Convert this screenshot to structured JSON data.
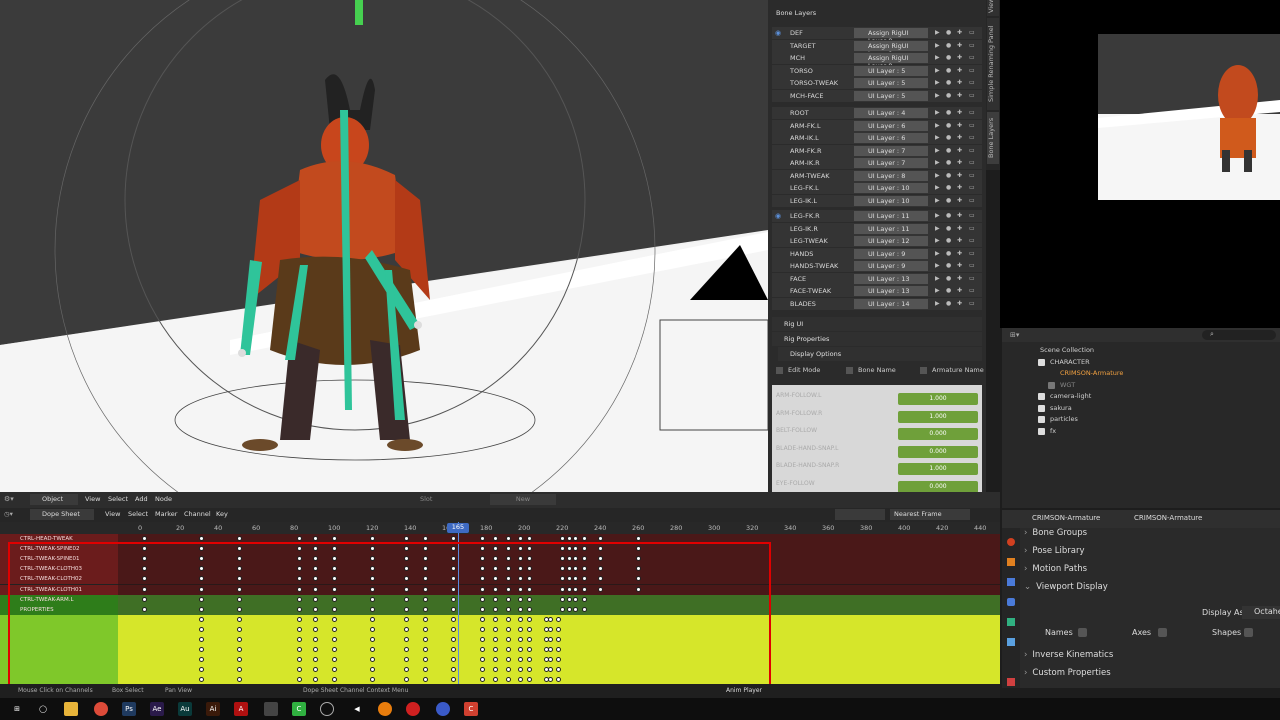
{
  "bone_layers": {
    "title": "Bone Layers",
    "rows": [
      {
        "name": "DEF",
        "layer": "Assign RigUI Layer",
        "num": "0",
        "eye": true
      },
      {
        "name": "TARGET",
        "layer": "Assign RigUI Layer",
        "num": "0",
        "eye": false
      },
      {
        "name": "MCH",
        "layer": "Assign RigUI Layer",
        "num": "0",
        "eye": false
      },
      {
        "name": "TORSO",
        "layer": "UI Layer :",
        "num": "5",
        "eye": false
      },
      {
        "name": "TORSO-TWEAK",
        "layer": "UI Layer :",
        "num": "5",
        "eye": false
      },
      {
        "name": "MCH-FACE",
        "layer": "UI Layer :",
        "num": "5",
        "eye": false
      },
      {
        "name": "ROOT",
        "layer": "UI Layer :",
        "num": "4",
        "eye": false
      },
      {
        "name": "ARM-FK.L",
        "layer": "UI Layer :",
        "num": "6",
        "eye": false
      },
      {
        "name": "ARM-IK.L",
        "layer": "UI Layer :",
        "num": "6",
        "eye": false
      },
      {
        "name": "ARM-FK.R",
        "layer": "UI Layer :",
        "num": "7",
        "eye": false
      },
      {
        "name": "ARM-IK.R",
        "layer": "UI Layer :",
        "num": "7",
        "eye": false
      },
      {
        "name": "ARM-TWEAK",
        "layer": "UI Layer :",
        "num": "8",
        "eye": false
      },
      {
        "name": "LEG-FK.L",
        "layer": "UI Layer :",
        "num": "10",
        "eye": false
      },
      {
        "name": "LEG-IK.L",
        "layer": "UI Layer :",
        "num": "10",
        "eye": false
      },
      {
        "name": "LEG-FK.R",
        "layer": "UI Layer :",
        "num": "11",
        "eye": true
      },
      {
        "name": "LEG-IK.R",
        "layer": "UI Layer :",
        "num": "11",
        "eye": false
      },
      {
        "name": "LEG-TWEAK",
        "layer": "UI Layer :",
        "num": "12",
        "eye": false
      },
      {
        "name": "HANDS",
        "layer": "UI Layer :",
        "num": "9",
        "eye": false
      },
      {
        "name": "HANDS-TWEAK",
        "layer": "UI Layer :",
        "num": "9",
        "eye": false
      },
      {
        "name": "FACE",
        "layer": "UI Layer :",
        "num": "13",
        "eye": false
      },
      {
        "name": "FACE-TWEAK",
        "layer": "UI Layer :",
        "num": "13",
        "eye": false
      },
      {
        "name": "BLADES",
        "layer": "UI Layer :",
        "num": "14",
        "eye": false
      }
    ],
    "rig_ui": "Rig UI",
    "rig_properties": "Rig Properties",
    "display_options": "Display Options",
    "edit_mode": "Edit Mode",
    "bone_name": "Bone Name",
    "armature_name": "Armature Name",
    "properties": [
      {
        "name": "ARM-FOLLOW.L",
        "value": "1.000"
      },
      {
        "name": "ARM-FOLLOW.R",
        "value": "1.000"
      },
      {
        "name": "BELT-FOLLOW",
        "value": "0.000"
      },
      {
        "name": "BLADE-HAND-SNAP.L",
        "value": "0.000"
      },
      {
        "name": "BLADE-HAND-SNAP.R",
        "value": "1.000"
      },
      {
        "name": "EYE-FOLLOW",
        "value": "0.000"
      }
    ]
  },
  "side_tabs": [
    "View",
    "Simple Renaming Panel",
    "Bone Layers"
  ],
  "outliner": {
    "rows": [
      {
        "label": "Scene Collection",
        "indent": 0,
        "cb": false
      },
      {
        "label": "CHARACTER",
        "indent": 1,
        "cb": true
      },
      {
        "label": "CRIMSON-Armature",
        "indent": 2,
        "cb": false,
        "highlight": true
      },
      {
        "label": "WGT",
        "indent": 2,
        "cb": true,
        "dim": true
      },
      {
        "label": "camera-light",
        "indent": 1,
        "cb": true
      },
      {
        "label": "sakura",
        "indent": 1,
        "cb": true
      },
      {
        "label": "particles",
        "indent": 1,
        "cb": true
      },
      {
        "label": "fx",
        "indent": 1,
        "cb": true
      }
    ]
  },
  "properties_panel": {
    "object1": "CRIMSON-Armature",
    "object2": "CRIMSON-Armature",
    "sections": [
      "Bone Groups",
      "Pose Library",
      "Motion Paths",
      "Viewport Display"
    ],
    "display_as_label": "Display As",
    "display_as_value": "Octahe",
    "names": "Names",
    "axes": "Axes",
    "shapes": "Shapes",
    "sections2": [
      "Inverse Kinematics",
      "Custom Properties"
    ]
  },
  "header": {
    "mode": "Object",
    "menus": [
      "View",
      "Select",
      "Add",
      "Node"
    ],
    "slot": "Slot",
    "new": "New"
  },
  "dope": {
    "editor": "Dope Sheet",
    "menus": [
      "View",
      "Select",
      "Marker",
      "Channel",
      "Key"
    ],
    "snap": "Nearest Frame",
    "ticks": [
      "0",
      "20",
      "40",
      "60",
      "80",
      "100",
      "120",
      "140",
      "160",
      "180",
      "200",
      "220",
      "240",
      "260",
      "280",
      "300",
      "320",
      "340",
      "360",
      "380",
      "400",
      "420",
      "440"
    ],
    "current_frame": "165",
    "channels": [
      {
        "name": "CTRL-HEAD-TWEAK",
        "color": "red"
      },
      {
        "name": "CTRL-TWEAK-SPINE02",
        "color": "red"
      },
      {
        "name": "CTRL-TWEAK-SPINE01",
        "color": "red"
      },
      {
        "name": "CTRL-TWEAK-CLOTH03",
        "color": "red"
      },
      {
        "name": "CTRL-TWEAK-CLOTH02",
        "color": "red"
      },
      {
        "name": "CTRL-TWEAK-CLOTH01",
        "color": "red"
      },
      {
        "name": "CTRL-TWEAK-ARM.L",
        "color": "green"
      },
      {
        "name": "PROPERTIES",
        "color": "green"
      },
      {
        "name": "",
        "color": "yellow"
      },
      {
        "name": "",
        "color": "yellow"
      },
      {
        "name": "",
        "color": "yellow"
      },
      {
        "name": "",
        "color": "yellow"
      },
      {
        "name": "",
        "color": "yellow"
      },
      {
        "name": "",
        "color": "yellow"
      },
      {
        "name": "",
        "color": "yellow"
      }
    ],
    "keyframes_red": [
      0,
      30,
      50,
      82,
      90,
      100,
      120,
      138,
      148,
      163,
      178,
      185,
      192,
      198,
      203,
      220,
      224,
      227,
      232,
      240,
      260
    ],
    "keyframes_green": [
      0,
      30,
      50,
      82,
      90,
      100,
      120,
      138,
      148,
      163,
      178,
      185,
      192,
      198,
      203,
      220,
      224,
      227,
      232
    ],
    "keyframes_yellow": [
      30,
      50,
      82,
      90,
      100,
      120,
      138,
      148,
      163,
      178,
      185,
      192,
      198,
      203,
      212,
      214,
      218
    ]
  },
  "status": {
    "left": "Mouse Click on Channels",
    "mid1": "Box Select",
    "mid2": "Pan View",
    "mid3": "Dope Sheet Channel Context Menu",
    "right": "Anim Player"
  }
}
